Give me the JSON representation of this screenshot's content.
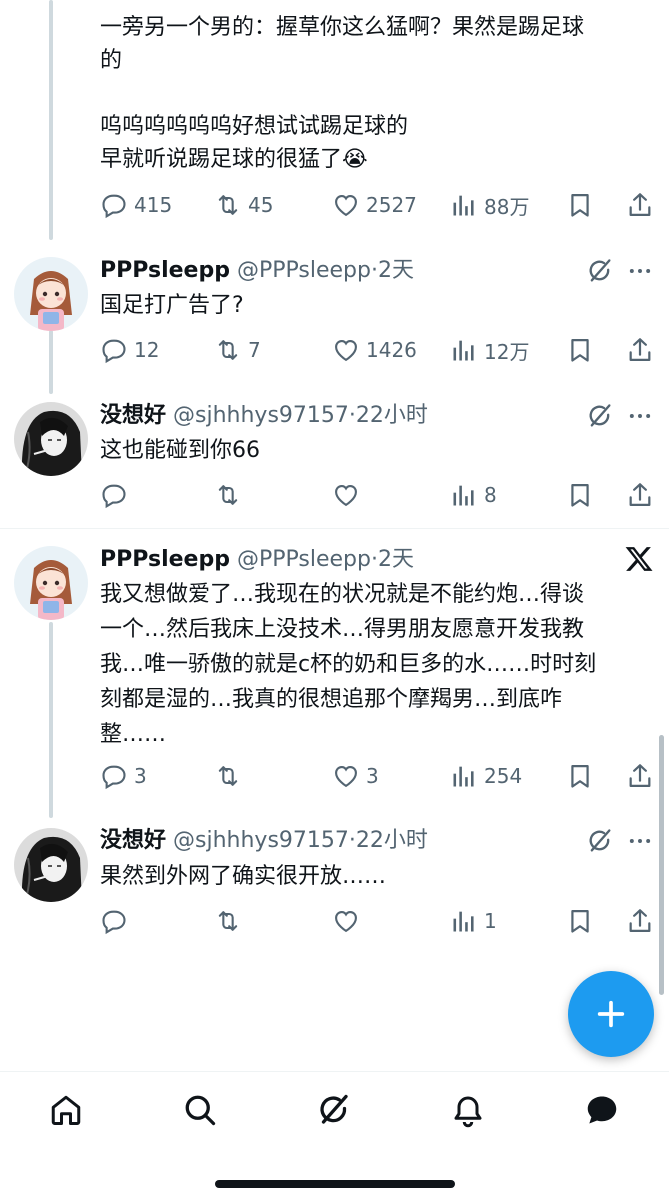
{
  "post0": {
    "lines": [
      "一旁另一个男的：握草你这么猛啊？果然是踢足球",
      "的",
      "",
      "呜呜呜呜呜呜好想试试踢足球的",
      "早就听说踢足球的很猛了😭"
    ],
    "replies": "415",
    "reposts": "45",
    "likes": "2527",
    "views": "88万"
  },
  "reply1": {
    "name": "PPPsleepp",
    "handle": "@PPPsleepp",
    "sep": "·",
    "time": "2天",
    "text": "国足打广告了?",
    "replies": "12",
    "reposts": "7",
    "likes": "1426",
    "views": "12万"
  },
  "reply2": {
    "name": "没想好",
    "handle": "@sjhhhys97157",
    "sep": "·",
    "time": "22小时",
    "text": "这也能碰到你66",
    "replies": "",
    "reposts": "",
    "likes": "",
    "views": "8"
  },
  "post3": {
    "name": "PPPsleepp",
    "handle": "@PPPsleepp",
    "sep": "·",
    "time": "2天",
    "lines": [
      "我又想做爱了…我现在的状况就是不能约炮…得谈",
      "一个…然后我床上没技术…得男朋友愿意开发我教",
      "我…唯一骄傲的就是c杯的奶和巨多的水……时时刻",
      "刻都是湿的…我真的很想追那个摩羯男…到底咋",
      "整……"
    ],
    "replies": "3",
    "reposts": "",
    "likes": "3",
    "views": "254"
  },
  "reply4": {
    "name": "没想好",
    "handle": "@sjhhhys97157",
    "sep": "·",
    "time": "22小时",
    "text": "果然到外网了确实很开放……",
    "replies": "",
    "reposts": "",
    "likes": "",
    "views": "1"
  },
  "colors": {
    "accent": "#1d9bf0",
    "text": "#0f1419",
    "muted": "#536471"
  },
  "fab": {
    "icon": "plus-icon"
  },
  "nav": [
    "home-icon",
    "search-icon",
    "grok-icon",
    "notifications-icon",
    "messages-icon"
  ]
}
